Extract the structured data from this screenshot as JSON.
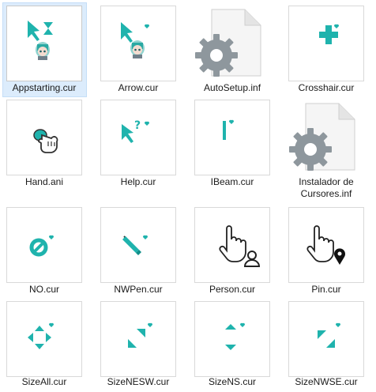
{
  "files": [
    {
      "name": "Appstarting.cur",
      "icon": "appstarting-cursor-icon",
      "selected": true
    },
    {
      "name": "Arrow.cur",
      "icon": "arrow-cursor-icon"
    },
    {
      "name": "AutoSetup.inf",
      "icon": "settings-file-icon"
    },
    {
      "name": "Crosshair.cur",
      "icon": "crosshair-cursor-icon"
    },
    {
      "name": "Hand.ani",
      "icon": "hand-cursor-icon"
    },
    {
      "name": "Help.cur",
      "icon": "help-cursor-icon"
    },
    {
      "name": "IBeam.cur",
      "icon": "ibeam-cursor-icon"
    },
    {
      "name": "Instalador de Cursores.inf",
      "icon": "settings-file-icon"
    },
    {
      "name": "NO.cur",
      "icon": "no-cursor-icon"
    },
    {
      "name": "NWPen.cur",
      "icon": "pen-cursor-icon"
    },
    {
      "name": "Person.cur",
      "icon": "person-cursor-icon"
    },
    {
      "name": "Pin.cur",
      "icon": "pin-cursor-icon"
    },
    {
      "name": "SizeAll.cur",
      "icon": "size-all-cursor-icon"
    },
    {
      "name": "SizeNESW.cur",
      "icon": "size-nesw-cursor-icon"
    },
    {
      "name": "SizeNS.cur",
      "icon": "size-ns-cursor-icon"
    },
    {
      "name": "SizeNWSE.cur",
      "icon": "size-nwse-cursor-icon"
    }
  ],
  "colors": {
    "accent": "#1fb3ad",
    "accent_dark": "#128f8a",
    "selection": "#dcecfc"
  }
}
